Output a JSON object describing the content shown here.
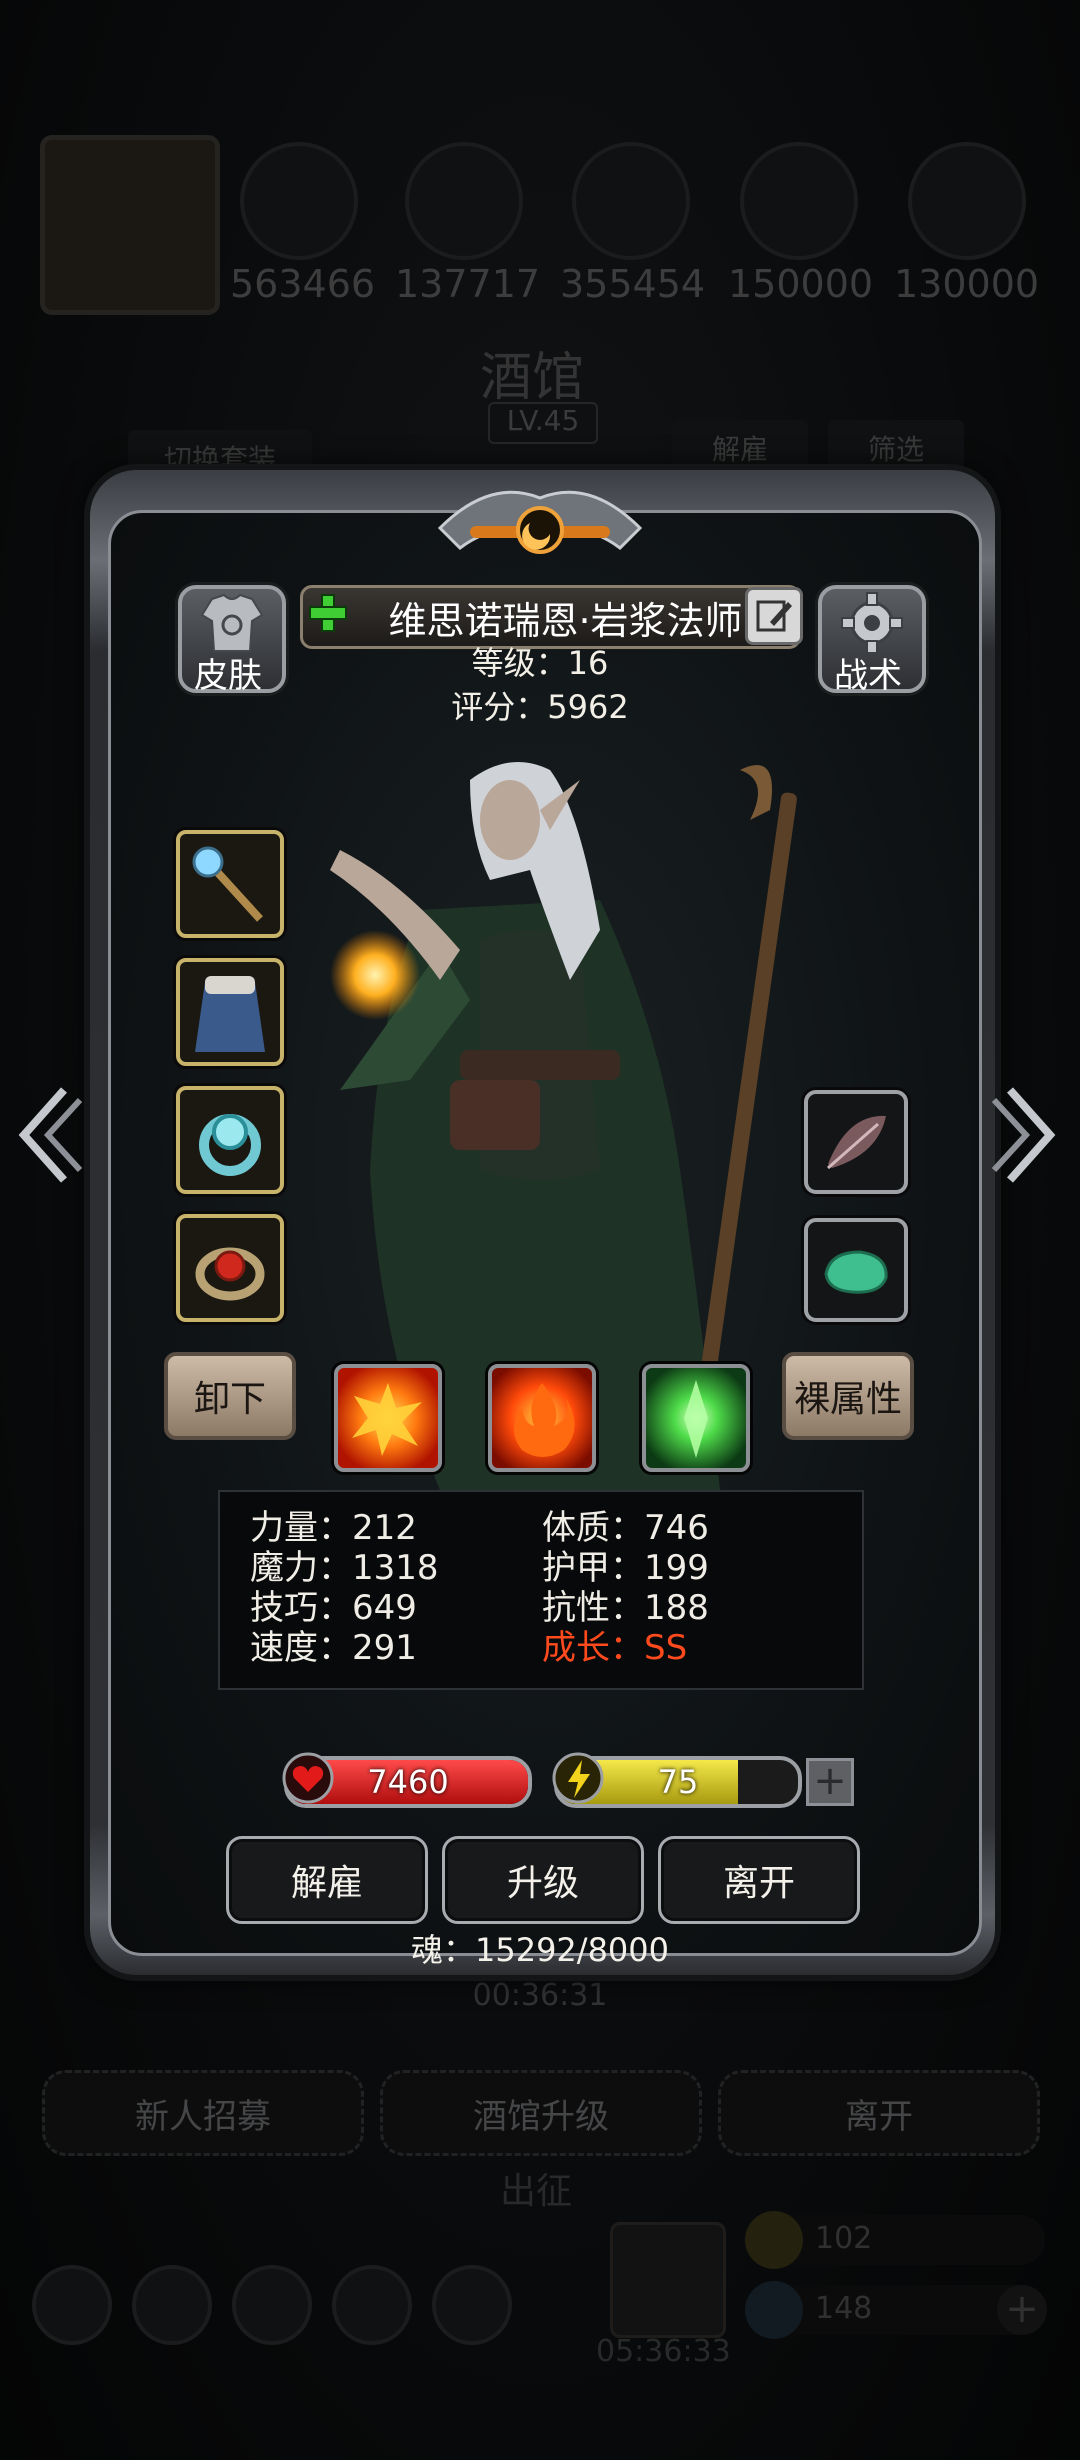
{
  "background": {
    "resources": [
      "563466",
      "137717",
      "355454",
      "150000",
      "130000"
    ],
    "tavern_title": "酒馆",
    "tavern_level": "LV.45",
    "switch_outfit": "切换套装",
    "dismiss": "解雇",
    "filter": "筛选",
    "timer": "00:36:31",
    "recruit": "新人招募",
    "tavern_upgrade": "酒馆升级",
    "leave": "离开",
    "expedition": "出征",
    "chest_timer": "05:36:33",
    "counter1": "102",
    "counter2": "148"
  },
  "dialog": {
    "hero_name": "维思诺瑞恩·岩浆法师",
    "level_text": "等级：16",
    "score_text": "评分：5962",
    "skin_label": "皮肤",
    "tactics_label": "战术",
    "unequip_label": "卸下",
    "naked_stats_label": "裸属性",
    "stats": {
      "strength": "力量：212",
      "magic": "魔力：1318",
      "skill": "技巧：649",
      "speed": "速度：291",
      "constitution": "体质：746",
      "armor": "护甲：199",
      "resistance": "抗性：188",
      "growth": "成长：SS"
    },
    "hp_value": "7460",
    "energy_value": "75",
    "energy_fill": 0.75,
    "buttons": {
      "dismiss": "解雇",
      "upgrade": "升级",
      "leave": "离开"
    },
    "soul_text": "魂：15292/8000"
  },
  "colors": {
    "growth": "#ff4a1e",
    "hp": "#d41818",
    "energy": "#d8cc2a"
  }
}
